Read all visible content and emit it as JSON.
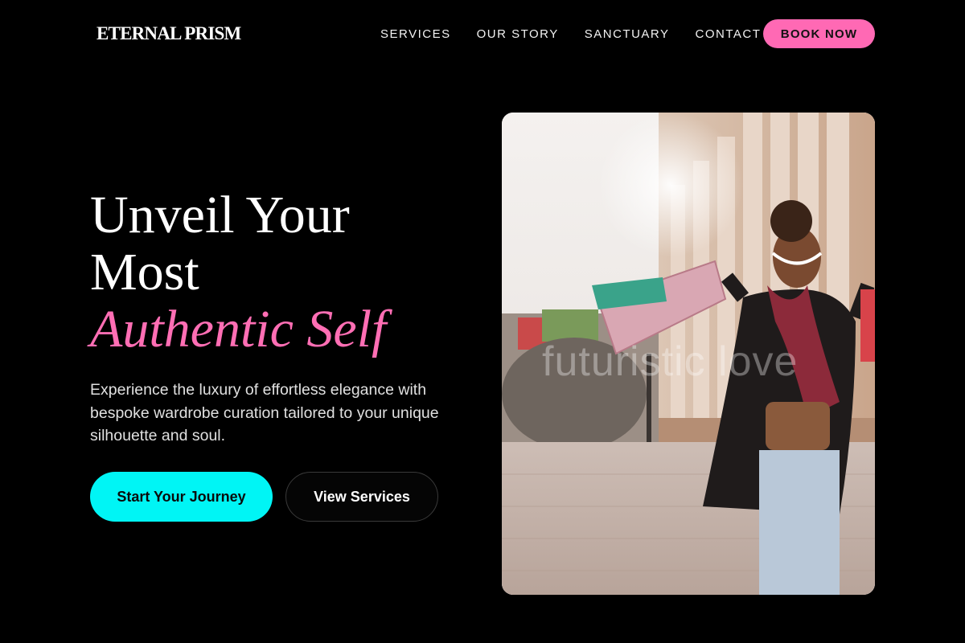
{
  "brand": {
    "name": "ETERNAL PRISM"
  },
  "nav": {
    "items": [
      {
        "label": "SERVICES"
      },
      {
        "label": "OUR STORY"
      },
      {
        "label": "SANCTUARY"
      },
      {
        "label": "CONTACT"
      }
    ],
    "cta_label": "BOOK NOW"
  },
  "hero": {
    "title_line1": "Unveil Your",
    "title_line2": "Most",
    "title_accent": "Authentic Self",
    "subtitle": "Experience the luxury of effortless elegance with bespoke wardrobe curation tailored to your unique silhouette and soul.",
    "primary_button": "Start Your Journey",
    "secondary_button": "View Services"
  },
  "image": {
    "watermark": "futuristic love"
  },
  "colors": {
    "background": "#000000",
    "accent_pink": "#ff69b4",
    "accent_cyan": "#00f5f5"
  }
}
